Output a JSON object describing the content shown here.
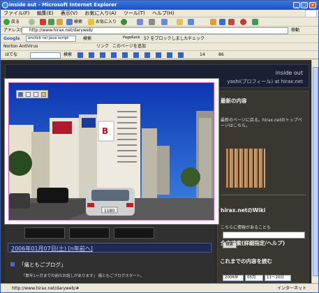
{
  "window": {
    "title": "inside out - Microsoft Internet Explorer"
  },
  "menu": [
    "ファイル(F)",
    "編集(E)",
    "表示(V)",
    "お気に入り(A)",
    "ツール(T)",
    "ヘルプ(H)"
  ],
  "toolbar": {
    "back": "戻る",
    "search": "検索",
    "favorites": "お気に入り"
  },
  "address": {
    "label": "アドレス(D)",
    "url": "http://www.hirax.net/daryweb/",
    "go": "移動"
  },
  "google": {
    "label": "Google",
    "query": "onclick rel java script",
    "search": "検索",
    "pagerank": "PageRank",
    "blocked": "57 をブロックしました",
    "check": "チェック"
  },
  "norton": {
    "label": "Norton AntiVirus",
    "link": "リンク",
    "add": "このページを追加"
  },
  "hatena": {
    "label": "はてな",
    "search": "検索",
    "count1": "14",
    "count2": "86"
  },
  "page": {
    "site_title": "inside out",
    "site_sub": "yashi(プロフィール) at hirax.net",
    "post_date": "2006年01月07日(土) [n年前へ]",
    "entry_title": "「痛ともごブログ」",
    "entry_text": "「数年1ヶ月までの前のお話しがあります」 痛ともごブログスタート。"
  },
  "sidebar": {
    "recent_head": "最新の内容",
    "recent_text": "最新のページに戻る。hirax.netのトップページはこちら。",
    "wiki_head": "hirax.netのWiki",
    "wiki_text": "こちらに情報があることも",
    "search_head": "全文検索(詳細指定/ヘルプ)",
    "search_btn": "検索",
    "archive_head": "これまでの内容を読む",
    "year": "2006年",
    "month": "05月",
    "range": "11〜20日"
  },
  "status": {
    "url": "http://www.hirax.net/daryweb/#",
    "zone": "インターネット"
  }
}
